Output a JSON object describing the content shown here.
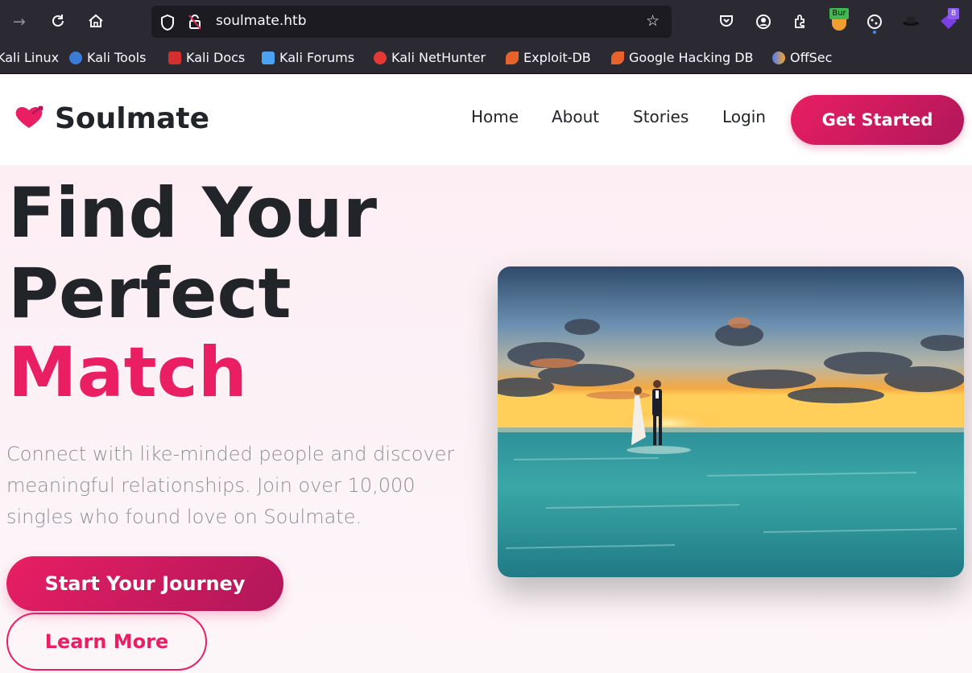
{
  "browser": {
    "url": "soulmate.htb",
    "bookmarks": [
      "Kali Linux",
      "Kali Tools",
      "Kali Docs",
      "Kali Forums",
      "Kali NetHunter",
      "Exploit-DB",
      "Google Hacking DB",
      "OffSec"
    ],
    "extension_label": "Bur",
    "badge_count": "8"
  },
  "site": {
    "brand": "Soulmate",
    "nav": [
      "Home",
      "About",
      "Stories",
      "Login"
    ],
    "cta": "Get Started"
  },
  "hero": {
    "title_line1": "Find Your",
    "title_line2": "Perfect",
    "title_accent": "Match",
    "description": "Connect with like-minded people and discover meaningful relationships. Join over 10,000 singles who found love on Soulmate.",
    "primary_button": "Start Your Journey",
    "secondary_button": "Learn More"
  },
  "colors": {
    "accent": "#e91e63",
    "text_dark": "#212529",
    "browser_bg": "#2b2a33"
  }
}
